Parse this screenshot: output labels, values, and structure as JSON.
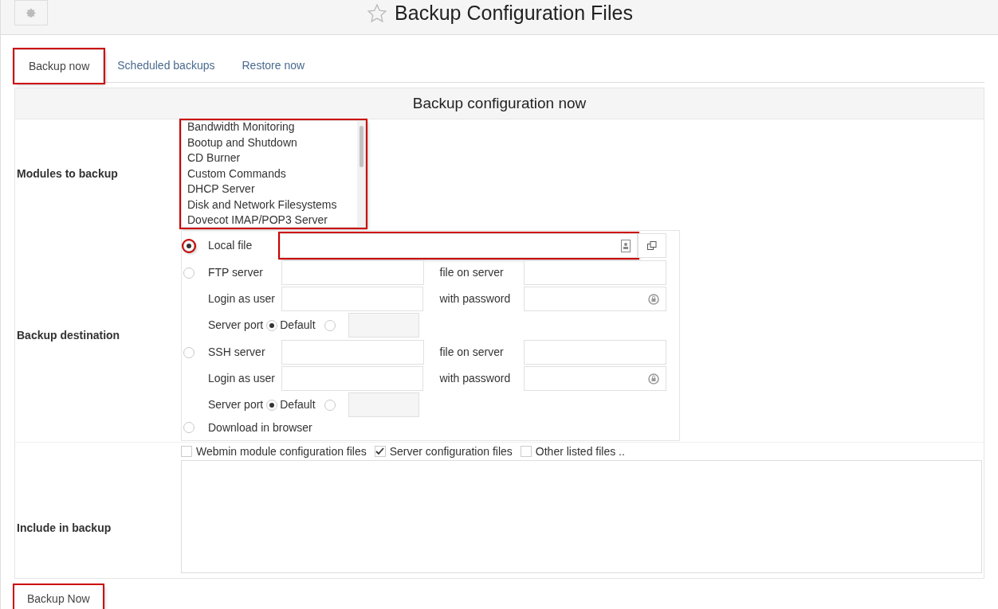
{
  "header": {
    "title": "Backup Configuration Files"
  },
  "tabs": [
    {
      "label": "Backup now",
      "selected": true,
      "highlighted": true
    },
    {
      "label": "Scheduled backups",
      "selected": false,
      "highlighted": false
    },
    {
      "label": "Restore now",
      "selected": false,
      "highlighted": false
    }
  ],
  "panel": {
    "title": "Backup configuration now",
    "modules": {
      "label": "Modules to backup",
      "highlighted": true,
      "items": [
        "Bandwidth Monitoring",
        "Bootup and Shutdown",
        "CD Burner",
        "Custom Commands",
        "DHCP Server",
        "Disk and Network Filesystems",
        "Dovecot IMAP/POP3 Server"
      ]
    },
    "destination": {
      "label": "Backup destination",
      "options": [
        {
          "kind": "local",
          "label": "Local file",
          "selected": true,
          "highlighted": true,
          "field_highlighted": true
        },
        {
          "kind": "remote",
          "label": "FTP server",
          "selected": false,
          "file_label": "file on server",
          "user_label": "Login as user",
          "password_label": "with password",
          "port_label": "Server port",
          "port_default": "Default",
          "port_default_selected": true
        },
        {
          "kind": "remote",
          "label": "SSH server",
          "selected": false,
          "file_label": "file on server",
          "user_label": "Login as user",
          "password_label": "with password",
          "port_label": "Server port",
          "port_default": "Default",
          "port_default_selected": true
        },
        {
          "kind": "browser",
          "label": "Download in browser",
          "selected": false
        }
      ]
    },
    "include": {
      "label": "Include in backup",
      "options": [
        {
          "label": "Webmin module configuration files",
          "checked": false
        },
        {
          "label": "Server configuration files",
          "checked": true
        },
        {
          "label": "Other listed files ..",
          "checked": false
        }
      ]
    }
  },
  "button": {
    "label": "Backup Now",
    "highlighted": true
  }
}
